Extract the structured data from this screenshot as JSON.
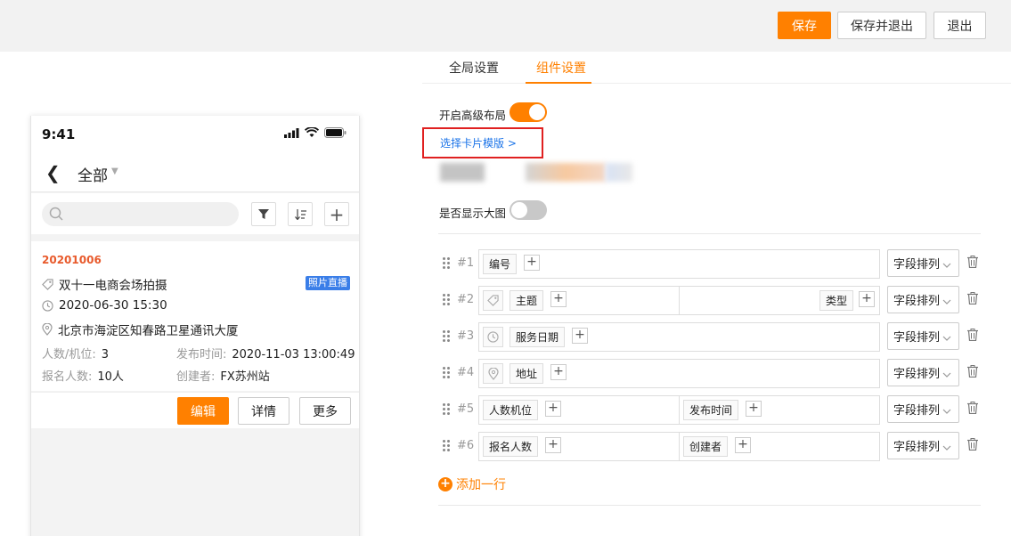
{
  "topbar": {
    "save_label": "保存",
    "save_exit_label": "保存并退出",
    "exit_label": "退出"
  },
  "phone": {
    "time": "9:41",
    "nav_title": "全部",
    "card": {
      "number": "20201006",
      "title": "双十一电商会场拍摄",
      "badge": "照片直播",
      "datetime": "2020-06-30 15:30",
      "address": "北京市海淀区知春路卫星通讯大厦",
      "people_key": "人数/机位:",
      "people_val": "3",
      "publish_key": "发布时间:",
      "publish_val": "2020-11-03 13:00:49",
      "signup_key": "报名人数:",
      "signup_val": "10人",
      "creator_key": "创建者:",
      "creator_val": "FX苏州站",
      "actions": {
        "edit": "编辑",
        "detail": "详情",
        "more": "更多"
      }
    }
  },
  "settings": {
    "tabs": [
      "全局设置",
      "组件设置"
    ],
    "advanced_layout_label": "开启高级布局",
    "advanced_layout_on": true,
    "template_link": "选择卡片模版 >",
    "show_big_image_label": "是否显示大图",
    "show_big_image_on": false,
    "sort_label": "字段排列",
    "add_row_label": "添加一行",
    "rows": [
      {
        "num": "#1",
        "left": "编号",
        "right": null
      },
      {
        "num": "#2",
        "left": "主题",
        "right": "类型"
      },
      {
        "num": "#3",
        "left": "服务日期",
        "right": null
      },
      {
        "num": "#4",
        "left": "地址",
        "right": null
      },
      {
        "num": "#5",
        "left": "人数机位",
        "right": "发布时间"
      },
      {
        "num": "#6",
        "left": "报名人数",
        "right": "创建者"
      }
    ]
  },
  "colors": {
    "accent": "#ff8000",
    "link": "#1a73e8",
    "highlight_border": "#e02020",
    "card_number": "#e85a2c",
    "badge": "#3a7ee8"
  }
}
